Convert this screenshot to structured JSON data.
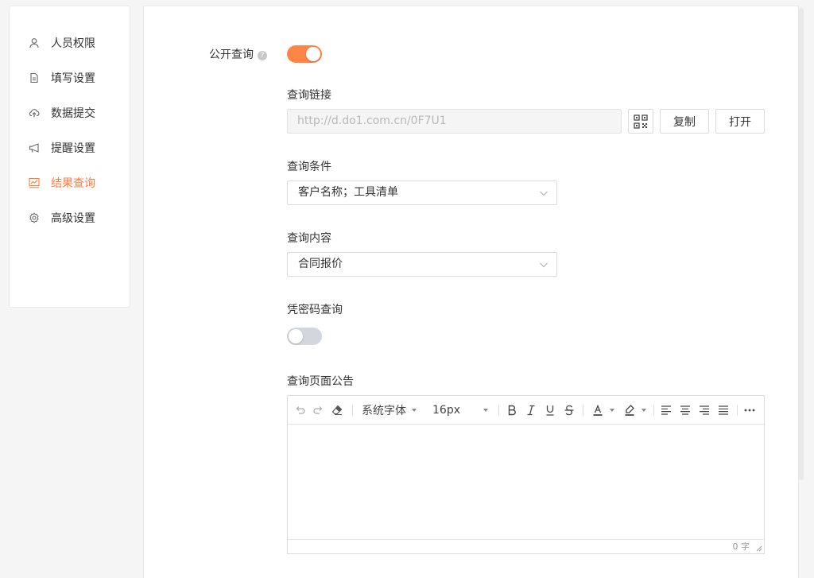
{
  "sidebar": {
    "items": [
      {
        "label": "人员权限",
        "icon": "user-icon",
        "active": false
      },
      {
        "label": "填写设置",
        "icon": "document-icon",
        "active": false
      },
      {
        "label": "数据提交",
        "icon": "cloud-upload-icon",
        "active": false
      },
      {
        "label": "提醒设置",
        "icon": "megaphone-icon",
        "active": false
      },
      {
        "label": "结果查询",
        "icon": "chart-monitor-icon",
        "active": true
      },
      {
        "label": "高级设置",
        "icon": "gear-icon",
        "active": false
      }
    ]
  },
  "colors": {
    "accent": "#ff7a3d",
    "toggle_on": "#ff8547",
    "toggle_off": "#d3d6dc"
  },
  "public_query": {
    "label": "公开查询",
    "help": "?",
    "enabled": true
  },
  "query_link": {
    "label": "查询链接",
    "value": "http://d.do1.com.cn/0F7U1",
    "copy_button": "复制",
    "open_button": "打开"
  },
  "query_conditions": {
    "label": "查询条件",
    "value": "客户名称；工具清单"
  },
  "query_content": {
    "label": "查询内容",
    "value": "合同报价"
  },
  "password_query": {
    "label": "凭密码查询",
    "enabled": false
  },
  "announcement": {
    "label": "查询页面公告",
    "font_family": "系统字体",
    "font_size": "16px",
    "char_count": "0 字"
  }
}
